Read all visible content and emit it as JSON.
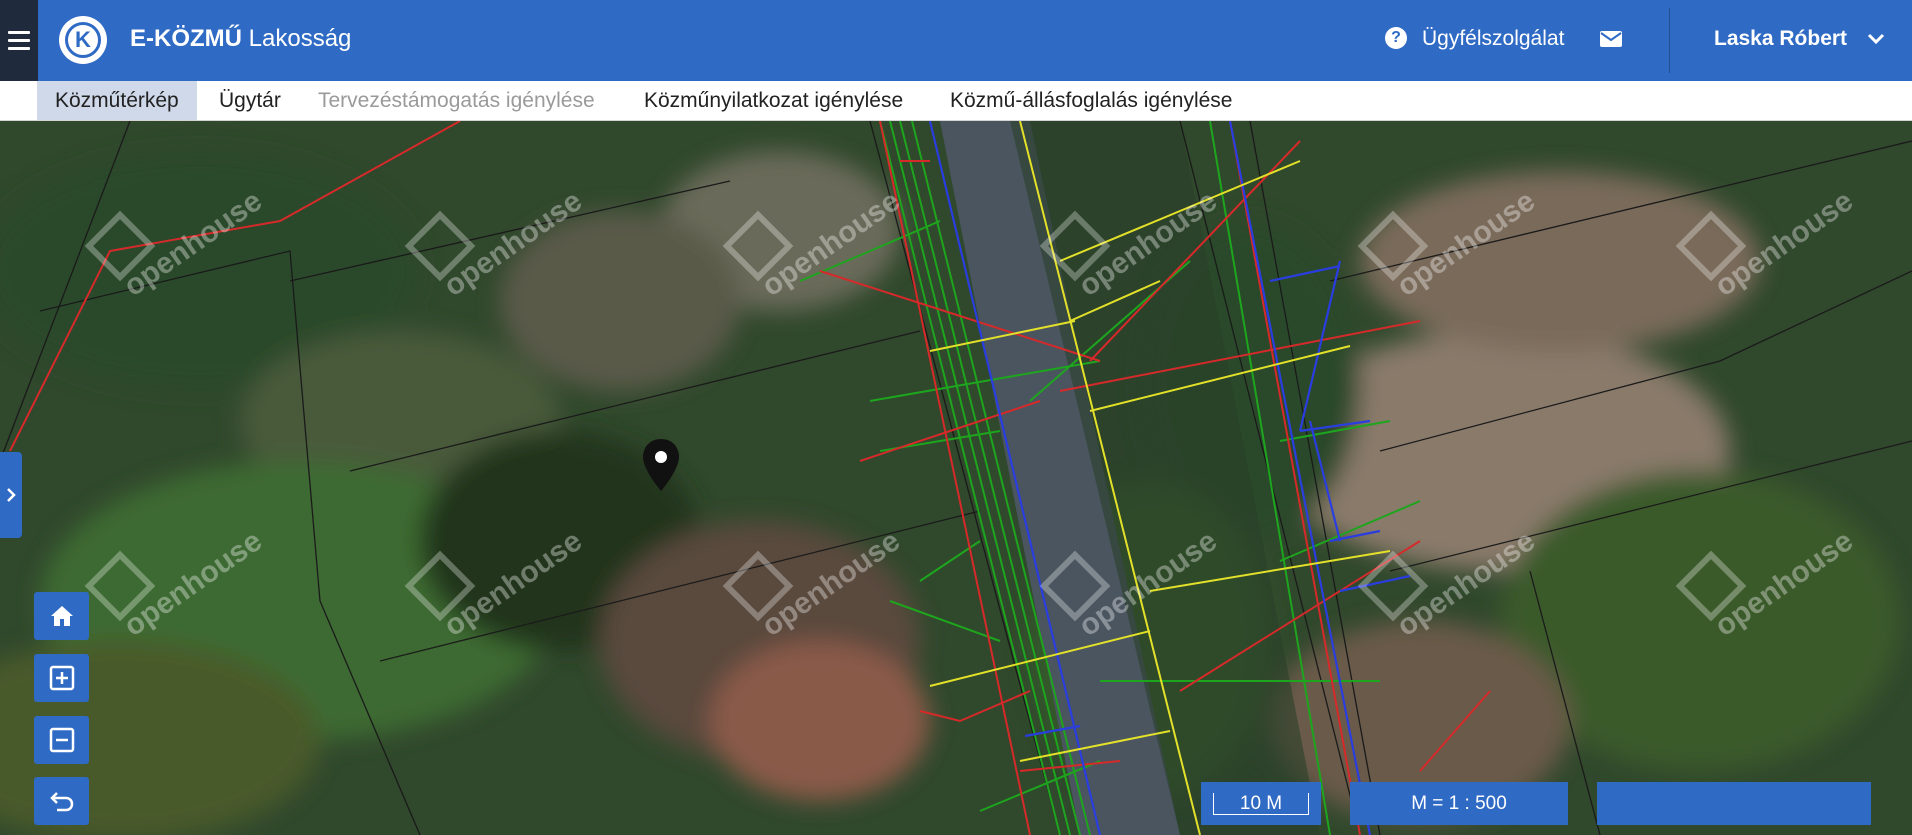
{
  "header": {
    "brand_bold": "E-KÖZMŰ",
    "brand_sub": "Lakosság",
    "logo_letter": "K",
    "help_label": "Ügyfélszolgálat",
    "help_glyph": "?",
    "user_name": "Laska Róbert",
    "colors": {
      "primary": "#2f6ac4",
      "dark": "#1f2a3c"
    }
  },
  "nav": {
    "tabs": [
      {
        "label": "Közműtérkép",
        "state": "active"
      },
      {
        "label": "Ügytár",
        "state": "normal"
      },
      {
        "label": "Tervezéstámogatás igénylése",
        "state": "disabled"
      },
      {
        "label": "Közműnyilatkozat igénylése",
        "state": "normal"
      },
      {
        "label": "Közmű-állásfoglalás igénylése",
        "state": "normal"
      }
    ]
  },
  "map": {
    "watermark": "openhouse",
    "controls": [
      "home-icon",
      "zoom-in-icon",
      "zoom-out-icon",
      "back-icon"
    ],
    "scale_bar": "10 M",
    "scale_ratio": "M = 1 : 500",
    "coordinates": "",
    "line_colors": {
      "red": "#d62a2a",
      "green": "#1ea51e",
      "blue": "#2a3ee0",
      "yellow": "#e3e02a",
      "black": "#1a1a1a"
    }
  }
}
